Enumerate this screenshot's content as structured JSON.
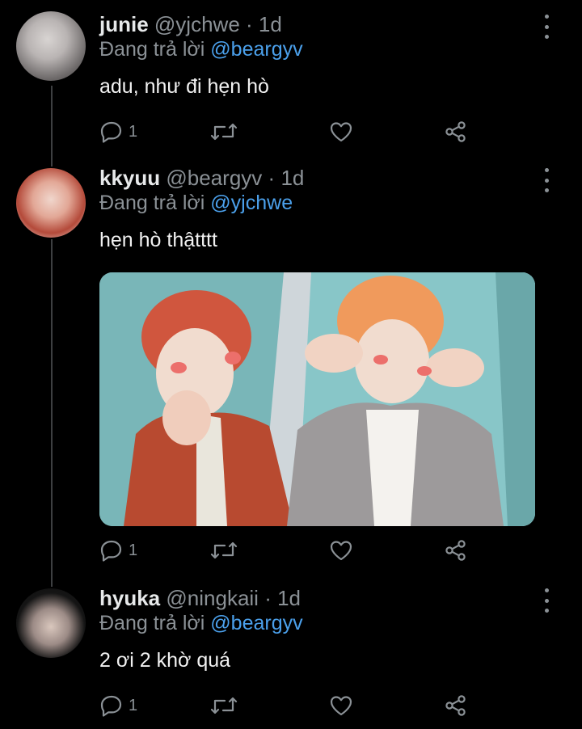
{
  "tweets": [
    {
      "name": "junie",
      "handle": "@yjchwe",
      "separator": "·",
      "time": "1d",
      "reply_prefix": "Đang trả lời",
      "reply_to": "@beargyv",
      "text": "adu, như đi hẹn hò",
      "reply_count": "1",
      "has_media": false
    },
    {
      "name": "kkyuu",
      "handle": "@beargyv",
      "separator": "·",
      "time": "1d",
      "reply_prefix": "Đang trả lời",
      "reply_to": "@yjchwe",
      "text": "hẹn hò thậtttt",
      "reply_count": "1",
      "has_media": true
    },
    {
      "name": "hyuka",
      "handle": "@ningkaii",
      "separator": "·",
      "time": "1d",
      "reply_prefix": "Đang trả lời",
      "reply_to": "@beargyv",
      "text": "2 ơi 2 khờ quá",
      "reply_count": "1",
      "has_media": false
    }
  ],
  "icons": {
    "reply": "reply-icon",
    "retweet": "retweet-icon",
    "like": "heart-icon",
    "share": "share-icon",
    "more": "more-vertical-icon"
  },
  "colors": {
    "background": "#000000",
    "mention": "#4ba0eb",
    "secondary_text": "#8b9196",
    "thread_line": "#3d3f41"
  }
}
